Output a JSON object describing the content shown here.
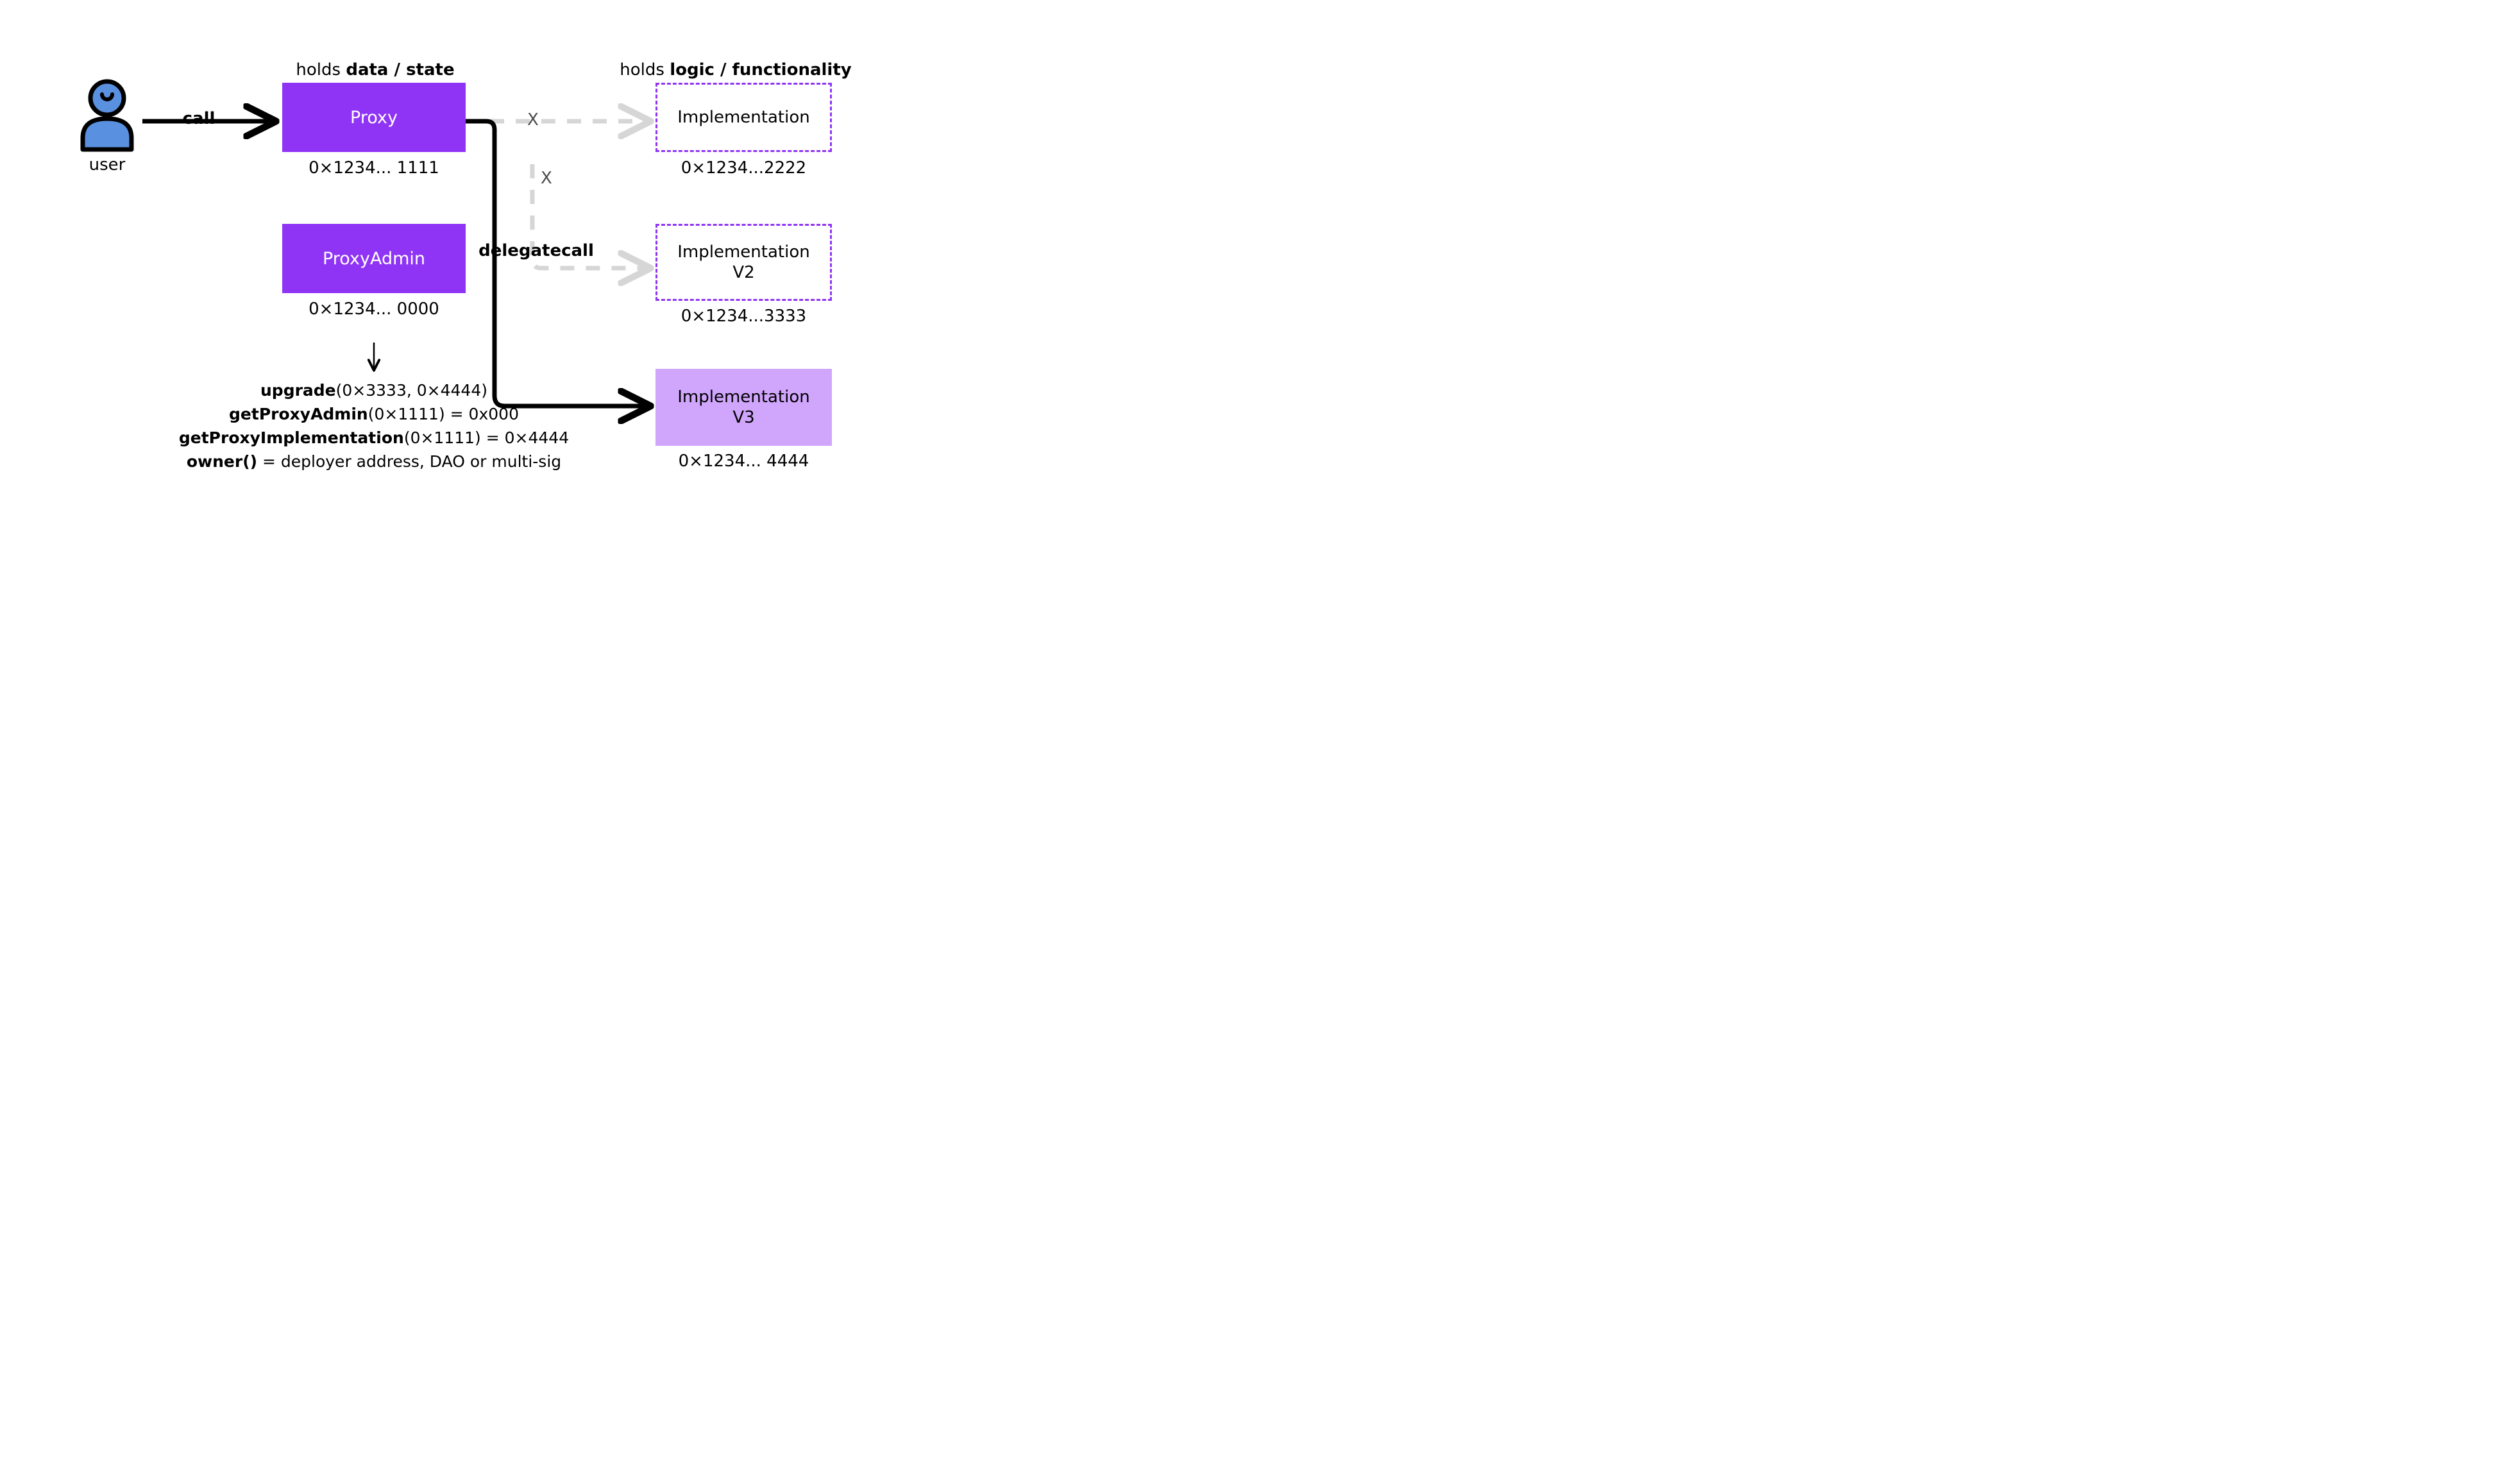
{
  "user": {
    "label": "user"
  },
  "arrows": {
    "call": "call",
    "delegatecall": "delegatecall",
    "x1": "X",
    "x2": "X"
  },
  "headers": {
    "data_pre": "holds ",
    "data_bold": "data / state",
    "logic_pre": "holds ",
    "logic_bold": "logic / functionality"
  },
  "proxy": {
    "label": "Proxy",
    "address": "0×1234... 1111"
  },
  "proxyAdmin": {
    "label": "ProxyAdmin",
    "address": "0×1234... 0000"
  },
  "impl1": {
    "line1": "Implementation",
    "address": "0×1234...2222"
  },
  "impl2": {
    "line1": "Implementation",
    "line2": "V2",
    "address": "0×1234...3333"
  },
  "impl3": {
    "line1": "Implementation",
    "line2": "V3",
    "address": "0×1234... 4444"
  },
  "calls": {
    "c1_fn": "upgrade",
    "c1_args": "(0×3333, 0×4444)",
    "c2_fn": "getProxyAdmin",
    "c2_args": "(0×1111) = 0x000",
    "c3_fn": "getProxyImplementation",
    "c3_args": "(0×1111) = 0×4444",
    "c4_fn": "owner()",
    "c4_rest": " = deployer address, DAO or multi-sig"
  }
}
